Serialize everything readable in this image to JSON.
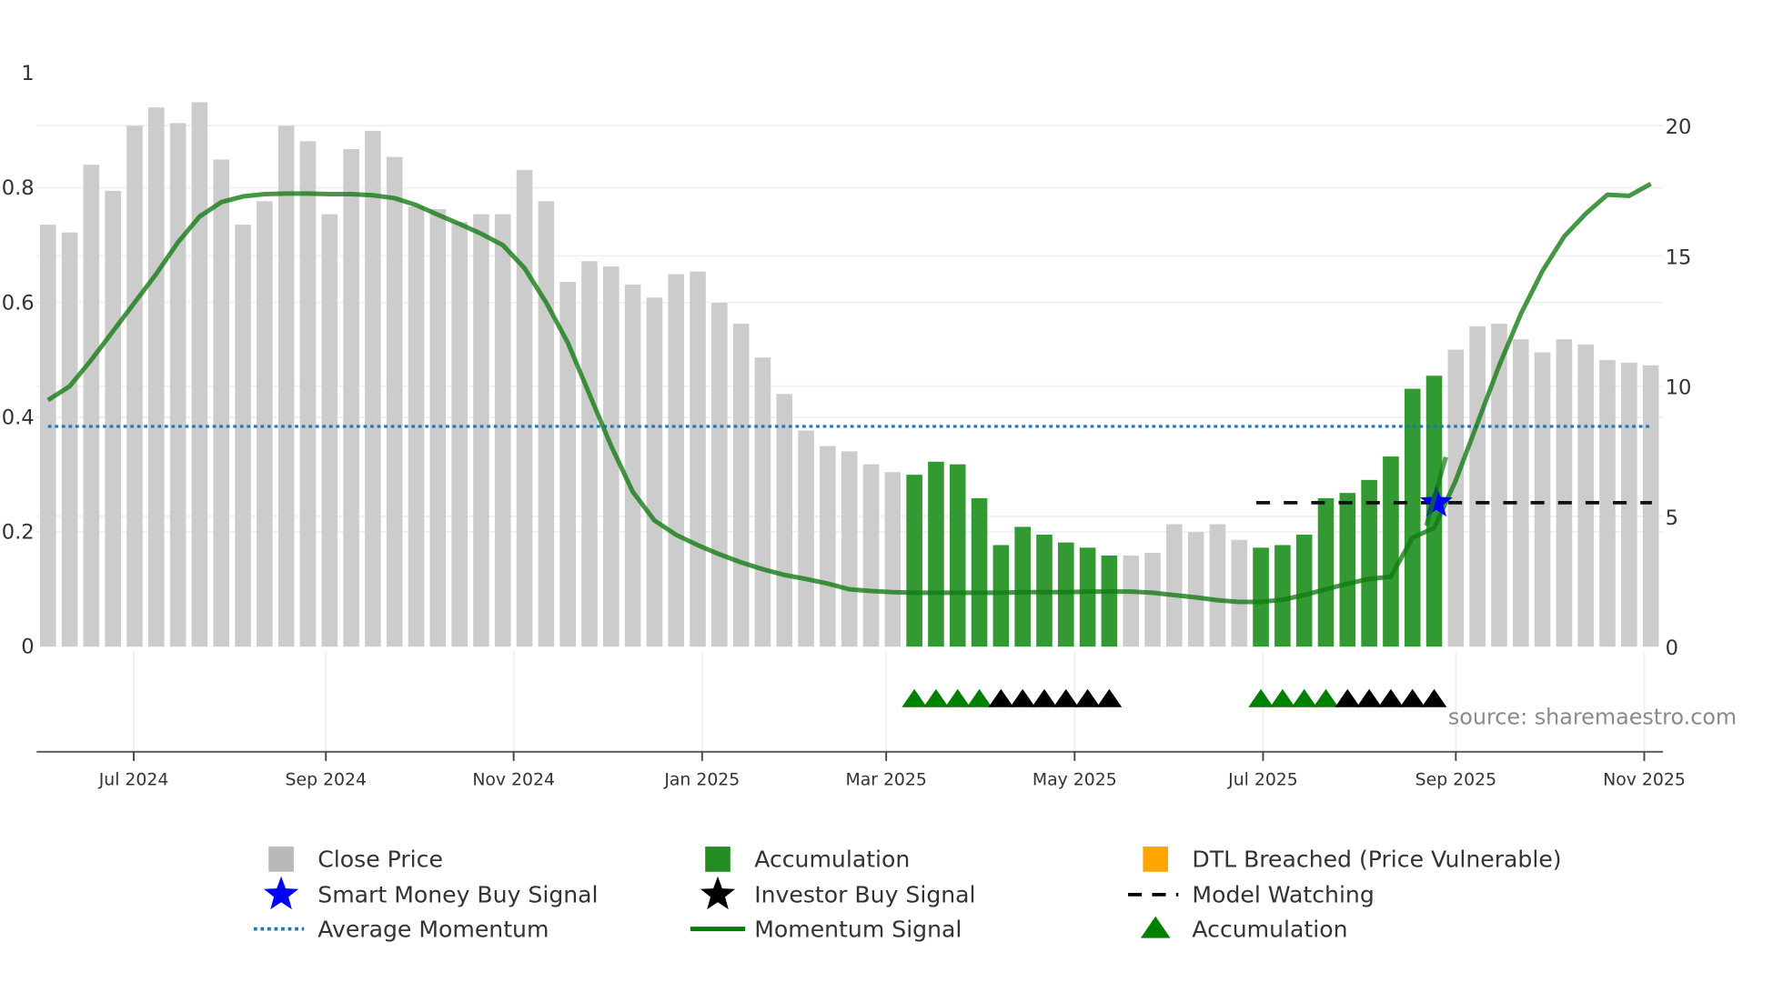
{
  "chart_data": {
    "type": "bar",
    "title": "",
    "x": "weekly bars (index 0-74)",
    "left_axis": {
      "ylim": [
        0,
        1
      ],
      "ticks": [
        0,
        0.2,
        0.4,
        0.6,
        0.8,
        1
      ],
      "tick_labels": [
        "0",
        "0.2",
        "0.4",
        "0.6",
        "0.8",
        "1"
      ]
    },
    "right_axis": {
      "ylim": [
        0,
        22
      ],
      "ticks": [
        0,
        5,
        10,
        15,
        20
      ],
      "tick_labels": [
        "0",
        "5",
        "10",
        "15",
        "20"
      ]
    },
    "x_ticks": [
      {
        "label": "Jul 2024",
        "pos": 3.96
      },
      {
        "label": "Sep 2024",
        "pos": 12.83
      },
      {
        "label": "Nov 2024",
        "pos": 21.5
      },
      {
        "label": "Jan 2025",
        "pos": 30.2
      },
      {
        "label": "Mar 2025",
        "pos": 38.7
      },
      {
        "label": "May 2025",
        "pos": 47.4
      },
      {
        "label": "Jul 2025",
        "pos": 56.1
      },
      {
        "label": "Sep 2025",
        "pos": 65.0
      },
      {
        "label": "Nov 2025",
        "pos": 73.7
      }
    ],
    "close_price": [
      16.2,
      15.9,
      18.5,
      17.5,
      20.0,
      20.7,
      20.1,
      20.9,
      18.7,
      16.2,
      17.1,
      20.0,
      19.4,
      16.6,
      19.1,
      19.8,
      18.8,
      16.9,
      16.8,
      16.3,
      16.6,
      16.6,
      18.3,
      17.1,
      14.0,
      14.8,
      14.6,
      13.9,
      13.4,
      14.3,
      14.4,
      13.2,
      12.4,
      11.1,
      9.7,
      8.3,
      7.7,
      7.5,
      7.0,
      6.7,
      6.6,
      7.1,
      7.0,
      5.7,
      3.9,
      4.6,
      4.3,
      4.0,
      3.8,
      3.5,
      3.5,
      3.6,
      4.7,
      4.4,
      4.7,
      4.1,
      3.8,
      3.9,
      4.3,
      5.7,
      5.9,
      6.4,
      7.3,
      9.9,
      10.4,
      11.4,
      12.3,
      12.4,
      11.8,
      11.3,
      11.8,
      11.6,
      11.0,
      10.9,
      10.8
    ],
    "accumulation_bars": [
      40,
      41,
      42,
      43,
      44,
      45,
      46,
      47,
      48,
      49,
      56,
      57,
      58,
      59,
      60,
      61,
      62,
      63,
      64
    ],
    "momentum_signal": [
      0.43,
      0.454,
      0.5,
      0.55,
      0.6,
      0.65,
      0.705,
      0.75,
      0.775,
      0.785,
      0.789,
      0.79,
      0.79,
      0.789,
      0.789,
      0.787,
      0.782,
      0.77,
      0.753,
      0.737,
      0.72,
      0.7,
      0.66,
      0.6,
      0.53,
      0.44,
      0.35,
      0.27,
      0.22,
      0.195,
      0.177,
      0.161,
      0.147,
      0.135,
      0.125,
      0.118,
      0.11,
      0.1,
      0.097,
      0.095,
      0.094,
      0.094,
      0.094,
      0.094,
      0.094,
      0.095,
      0.095,
      0.095,
      0.096,
      0.096,
      0.096,
      0.094,
      0.09,
      0.086,
      0.081,
      0.078,
      0.078,
      0.082,
      0.09,
      0.1,
      0.11,
      0.118,
      0.122,
      0.19,
      0.207,
      0.29,
      0.39,
      0.49,
      0.58,
      0.655,
      0.715,
      0.755,
      0.788,
      0.786,
      0.807
    ],
    "average_momentum": 0.384,
    "model_watching": {
      "value": 0.251,
      "from": 56,
      "to": 74
    },
    "smart_money_buy_signal": {
      "index": 64.1,
      "value": 0.251
    },
    "accumulation_markers": [
      40,
      41,
      42,
      43,
      56,
      57,
      58,
      59
    ],
    "investor_buy_markers": [
      44,
      45,
      46,
      47,
      48,
      49,
      60,
      61,
      62,
      63,
      64
    ],
    "legend": [
      {
        "label": "Close Price",
        "color": "#b9b9b9",
        "symbol": "square"
      },
      {
        "label": "Accumulation",
        "color": "#228b22",
        "symbol": "square"
      },
      {
        "label": "DTL Breached (Price Vulnerable)",
        "color": "#ffa500",
        "symbol": "square"
      },
      {
        "label": "Smart Money Buy Signal",
        "color": "#0000ff",
        "symbol": "star"
      },
      {
        "label": "Investor Buy Signal",
        "color": "#000000",
        "symbol": "star"
      },
      {
        "label": "Model Watching",
        "color": "#000000",
        "symbol": "dash"
      },
      {
        "label": "Average Momentum",
        "color": "#1f77b4",
        "symbol": "dot"
      },
      {
        "label": "Momentum Signal",
        "color": "#008000",
        "symbol": "line"
      },
      {
        "label": "Accumulation",
        "color": "#008000",
        "symbol": "triangle"
      }
    ],
    "legend_position": "bottom",
    "source": "source: sharemaestro.com"
  }
}
